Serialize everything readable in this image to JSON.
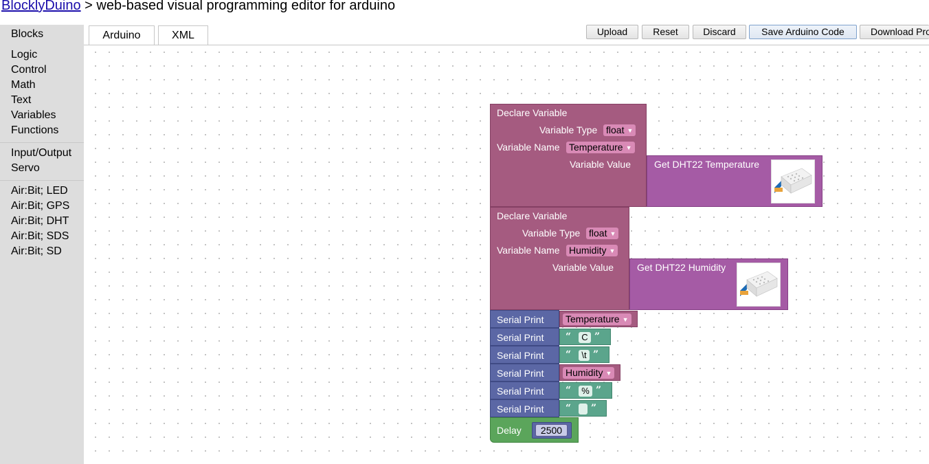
{
  "header": {
    "link_text": "BlocklyDuino",
    "tagline": " > web-based visual programming editor for arduino"
  },
  "sidebar": {
    "title": "Blocks",
    "groups": [
      [
        "Logic",
        "Control",
        "Math",
        "Text",
        "Variables",
        "Functions"
      ],
      [
        "Input/Output",
        "Servo"
      ],
      [
        "Air:Bit; LED",
        "Air:Bit; GPS",
        "Air:Bit; DHT",
        "Air:Bit; SDS",
        "Air:Bit; SD"
      ]
    ]
  },
  "tabs": [
    {
      "label": "Arduino"
    },
    {
      "label": "XML"
    }
  ],
  "toolbar": {
    "upload": "Upload",
    "reset": "Reset",
    "discard": "Discard",
    "save_arduino": "Save Arduino Code",
    "download": "Download Pro"
  },
  "colors": {
    "variable_block": "#a55b80",
    "dht_block": "#a55ba5",
    "serial_block": "#5b67a5",
    "text_block": "#5ba58c",
    "delay_block": "#5ba55b",
    "sidebar_bg": "#dddddd"
  },
  "blocks": {
    "declare_temp": {
      "title": "Declare Variable",
      "type_label": "Variable Type",
      "type_value": "float",
      "name_label": "Variable Name",
      "name_value": "Temperature",
      "value_label": "Variable Value",
      "sensor_label": "Get DHT22 Temperature",
      "sensor_icon": "dht22-sensor-image"
    },
    "declare_hum": {
      "title": "Declare Variable",
      "type_label": "Variable Type",
      "type_value": "float",
      "name_label": "Variable Name",
      "name_value": "Humidity",
      "value_label": "Variable Value",
      "sensor_label": "Get DHT22 Humidity",
      "sensor_icon": "dht22-sensor-image"
    },
    "serial_prints": [
      {
        "label": "Serial Print",
        "kind": "variable",
        "value": "Temperature"
      },
      {
        "label": "Serial Print",
        "kind": "text",
        "value": "C"
      },
      {
        "label": "Serial Print",
        "kind": "text",
        "value": "\\t"
      },
      {
        "label": "Serial Print",
        "kind": "variable",
        "value": "Humidity"
      },
      {
        "label": "Serial Print",
        "kind": "text",
        "value": "%"
      },
      {
        "label": "Serial Print",
        "kind": "text",
        "value": " "
      }
    ],
    "delay": {
      "label": "Delay",
      "value": "2500"
    },
    "dropdown_arrow": "▼",
    "quote_open": "“",
    "quote_close": "”"
  }
}
